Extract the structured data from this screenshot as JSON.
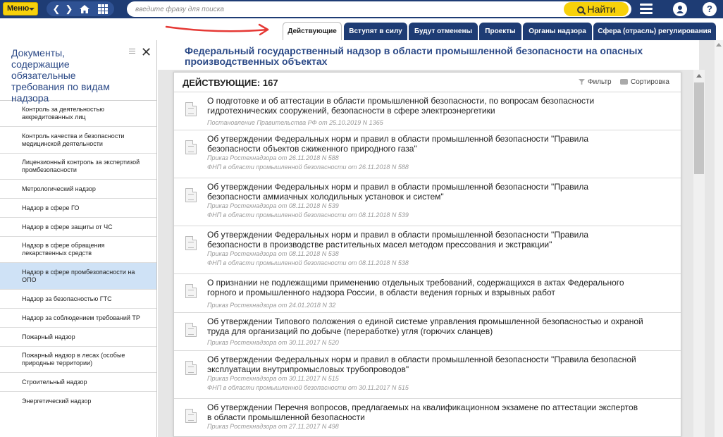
{
  "topbar": {
    "menu_label": "Меню",
    "search_placeholder": "введите фразу для поиска",
    "find_label": "Найти",
    "user_icon": "user-icon",
    "help_label": "?"
  },
  "tabs": [
    {
      "label": "Действующие",
      "active": true
    },
    {
      "label": "Вступят в силу",
      "active": false
    },
    {
      "label": "Будут отменены",
      "active": false
    },
    {
      "label": "Проекты",
      "active": false
    },
    {
      "label": "Органы надзора",
      "active": false
    },
    {
      "label": "Сфера (отрасль) регулирования",
      "active": false
    }
  ],
  "sidebar": {
    "title": "Документы, содержащие обязательные требования по видам надзора",
    "items": [
      {
        "label": "Контроль за деятельностью аккредитованных лиц"
      },
      {
        "label": "Контроль качества и безопасности медицинской деятельности"
      },
      {
        "label": "Лицензионный контроль за экспертизой промбезопасности"
      },
      {
        "label": "Метрологический надзор"
      },
      {
        "label": "Надзор в сфере ГО"
      },
      {
        "label": "Надзор в сфере защиты от ЧС"
      },
      {
        "label": "Надзор в сфере обращения лекарственных средств"
      },
      {
        "label": "Надзор в сфере промбезопасности на ОПО",
        "active": true
      },
      {
        "label": "Надзор за безопасностью ГТС"
      },
      {
        "label": "Надзор за соблюдением требований ТР"
      },
      {
        "label": "Пожарный надзор"
      },
      {
        "label": "Пожарный надзор в лесах (особые природные территории)"
      },
      {
        "label": "Строительный надзор"
      },
      {
        "label": "Энергетический надзор"
      }
    ]
  },
  "main": {
    "title": "Федеральный государственный надзор в области промышленной безопасности на опасных производственных объектах",
    "count_label": "ДЕЙСТВУЮЩИЕ: 167",
    "filter_label": "Фильтр",
    "sort_label": "Сортировка",
    "documents": [
      {
        "title": "О подготовке и об аттестации в области промышленной безопасности, по вопросам безопасности гидротехнических сооружений, безопасности в сфере электроэнергетики",
        "meta": [
          "Постановление Правительства РФ от 25.10.2019 N 1365"
        ]
      },
      {
        "title": "Об утверждении Федеральных норм и правил в области промышленной безопасности \"Правила безопасности объектов сжиженного природного газа\"",
        "meta": [
          "Приказ Ростехнадзора от 26.11.2018 N 588",
          "ФНП в области промышленной безопасности от 26.11.2018 N 588"
        ]
      },
      {
        "title": "Об утверждении Федеральных норм и правил в области промышленной безопасности \"Правила безопасности аммиачных холодильных установок и систем\"",
        "meta": [
          "Приказ Ростехнадзора от 08.11.2018 N 539",
          "ФНП в области промышленной безопасности от 08.11.2018 N 539"
        ]
      },
      {
        "title": "Об утверждении Федеральных норм и правил в области промышленной безопасности \"Правила безопасности в производстве растительных масел методом прессования и экстракции\"",
        "meta": [
          "Приказ Ростехнадзора от 08.11.2018 N 538",
          "ФНП в области промышленной безопасности от 08.11.2018 N 538"
        ]
      },
      {
        "title": "О признании не подлежащими применению отдельных требований, содержащихся в актах Федерального горного и промышленного надзора России, в области ведения горных и взрывных работ",
        "meta": [
          "Приказ Ростехнадзора от 24.01.2018 N 32"
        ]
      },
      {
        "title": "Об утверждении Типового положения о единой системе управления промышленной безопасностью и охраной труда для организаций по добыче (переработке) угля (горючих сланцев)",
        "meta": [
          "Приказ Ростехнадзора от 30.11.2017 N 520"
        ]
      },
      {
        "title": "Об утверждении Федеральных норм и правил в области промышленной безопасности \"Правила безопасной эксплуатации внутрипромысловых трубопроводов\"",
        "meta": [
          "Приказ Ростехнадзора от 30.11.2017 N 515",
          "ФНП в области промышленной безопасности от 30.11.2017 N 515"
        ]
      },
      {
        "title": "Об утверждении Перечня вопросов, предлагаемых на квалификационном экзамене по аттестации экспертов в области промышленной безопасности",
        "meta": [
          "Приказ Ростехнадзора от 27.11.2017 N 498"
        ]
      }
    ]
  }
}
